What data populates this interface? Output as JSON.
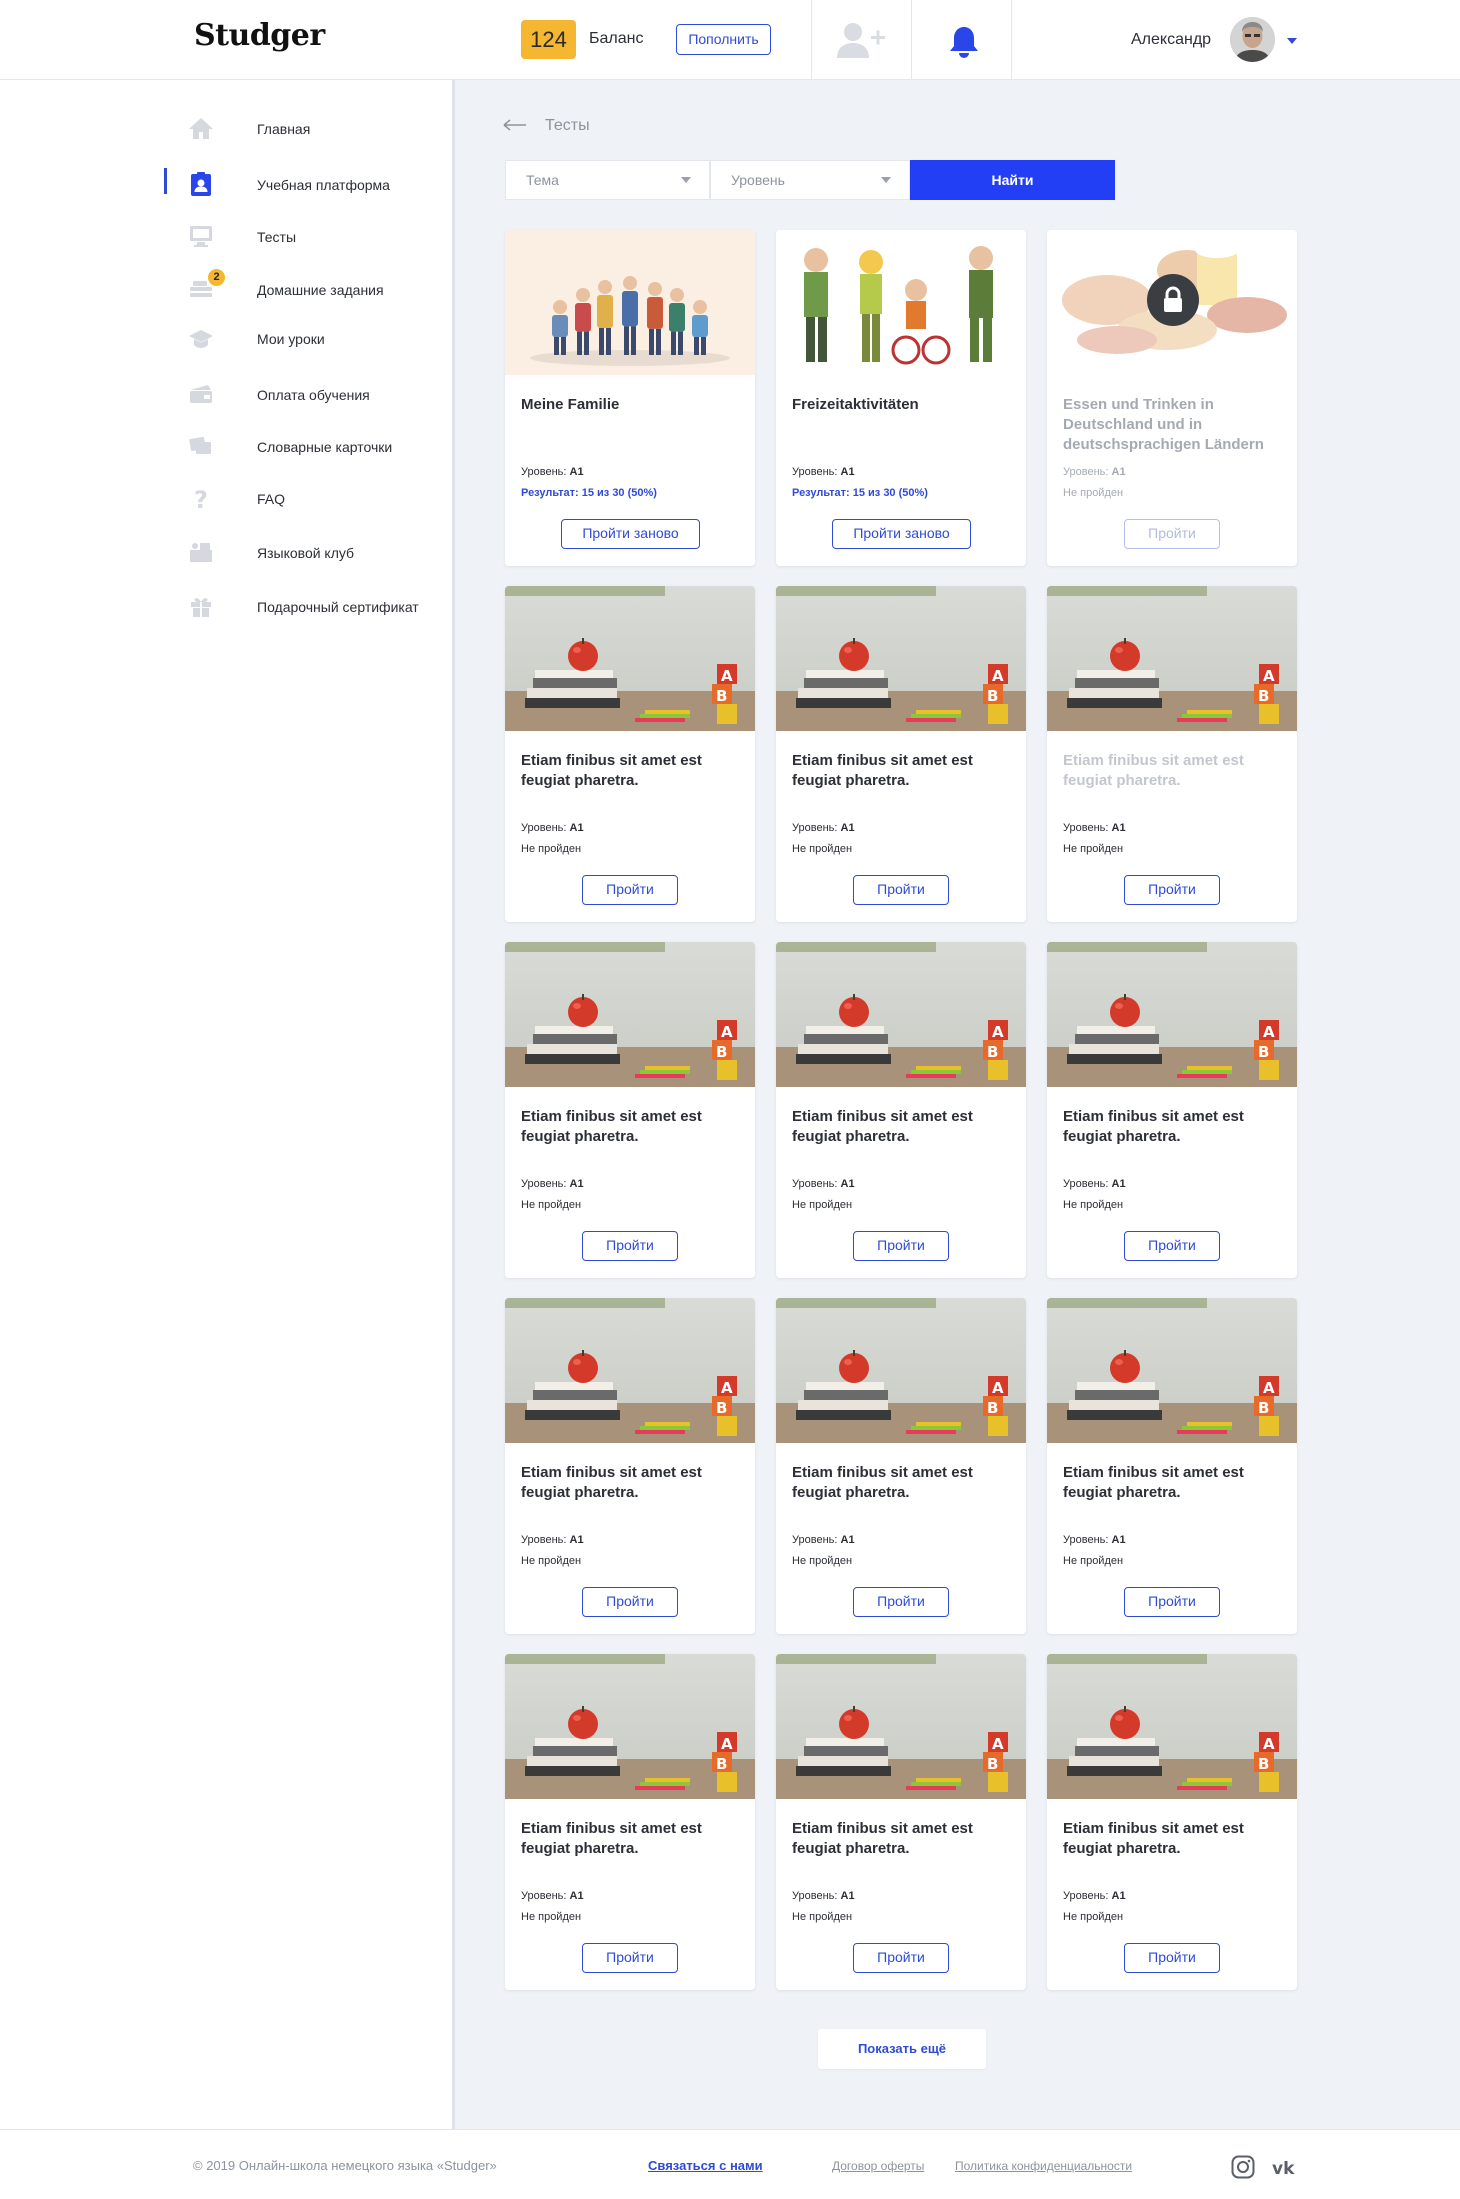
{
  "header": {
    "logo": "Studger",
    "balance_value": "124",
    "balance_label": "Баланс",
    "topup_label": "Пополнить",
    "user_name": "Александр"
  },
  "sidebar": {
    "items": [
      {
        "label": "Главная",
        "icon": "home-icon"
      },
      {
        "label": "Учебная платформа",
        "icon": "clipboard-user-icon",
        "active": true
      },
      {
        "label": "Тесты",
        "icon": "monitor-icon"
      },
      {
        "label": "Домашние задания",
        "icon": "homework-icon",
        "badge": "2"
      },
      {
        "label": "Мои уроки",
        "icon": "graduation-cap-icon"
      },
      {
        "label": "Оплата обучения",
        "icon": "payment-icon"
      },
      {
        "label": "Словарные карточки",
        "icon": "cards-icon"
      },
      {
        "label": "FAQ",
        "icon": "question-icon"
      },
      {
        "label": "Языковой клуб",
        "icon": "club-icon"
      },
      {
        "label": "Подарочный сертификат",
        "icon": "gift-icon"
      }
    ]
  },
  "breadcrumb": {
    "label": "Тесты"
  },
  "filters": {
    "topic_placeholder": "Тема",
    "level_placeholder": "Уровень",
    "find_label": "Найти"
  },
  "cards": [
    {
      "title": "Meine Familie",
      "level_prefix": "Уровень: ",
      "level": "A1",
      "status": "Результат: 15 из 30 (50%)",
      "button": "Пройти заново",
      "image": "family-illustration"
    },
    {
      "title": "Freizeitaktivitäten",
      "level_prefix": "Уровень: ",
      "level": "A1",
      "status": "Результат: 15 из 30 (50%)",
      "button": "Пройти заново",
      "image": "hobbies-illustration"
    },
    {
      "title": "Essen und Trinken in Deutschland und in deutschsprachigen Ländern",
      "level_prefix": "Уровень: ",
      "level": "A1",
      "status": "Не пройден",
      "button": "Пройти",
      "image": "food-illustration",
      "locked": true
    },
    {
      "title": "Etiam finibus sit amet est feugiat pharetra.",
      "level_prefix": "Уровень: ",
      "level": "A1",
      "status": "Не пройден",
      "button": "Пройти",
      "image": "books-apple-photo"
    },
    {
      "title": "Etiam finibus sit amet est feugiat pharetra.",
      "level_prefix": "Уровень: ",
      "level": "A1",
      "status": "Не пройден",
      "button": "Пройти",
      "image": "books-apple-photo"
    },
    {
      "title": "Etiam finibus sit amet est feugiat pharetra.",
      "level_prefix": "Уровень: ",
      "level": "A1",
      "status": "Не пройден",
      "button": "Пройти",
      "image": "books-apple-photo",
      "dim": true
    },
    {
      "title": "Etiam finibus sit amet est feugiat pharetra.",
      "level_prefix": "Уровень: ",
      "level": "A1",
      "status": "Не пройден",
      "button": "Пройти",
      "image": "books-apple-photo"
    },
    {
      "title": "Etiam finibus sit amet est feugiat pharetra.",
      "level_prefix": "Уровень: ",
      "level": "A1",
      "status": "Не пройден",
      "button": "Пройти",
      "image": "books-apple-photo"
    },
    {
      "title": "Etiam finibus sit amet est feugiat pharetra.",
      "level_prefix": "Уровень: ",
      "level": "A1",
      "status": "Не пройден",
      "button": "Пройти",
      "image": "books-apple-photo"
    },
    {
      "title": "Etiam finibus sit amet est feugiat pharetra.",
      "level_prefix": "Уровень: ",
      "level": "A1",
      "status": "Не пройден",
      "button": "Пройти",
      "image": "books-apple-photo"
    },
    {
      "title": "Etiam finibus sit amet est feugiat pharetra.",
      "level_prefix": "Уровень: ",
      "level": "A1",
      "status": "Не пройден",
      "button": "Пройти",
      "image": "books-apple-photo"
    },
    {
      "title": "Etiam finibus sit amet est feugiat pharetra.",
      "level_prefix": "Уровень: ",
      "level": "A1",
      "status": "Не пройден",
      "button": "Пройти",
      "image": "books-apple-photo"
    },
    {
      "title": "Etiam finibus sit amet est feugiat pharetra.",
      "level_prefix": "Уровень: ",
      "level": "A1",
      "status": "Не пройден",
      "button": "Пройти",
      "image": "books-apple-photo"
    },
    {
      "title": "Etiam finibus sit amet est feugiat pharetra.",
      "level_prefix": "Уровень: ",
      "level": "A1",
      "status": "Не пройден",
      "button": "Пройти",
      "image": "books-apple-photo"
    },
    {
      "title": "Etiam finibus sit amet est feugiat pharetra.",
      "level_prefix": "Уровень: ",
      "level": "A1",
      "status": "Не пройден",
      "button": "Пройти",
      "image": "books-apple-photo"
    }
  ],
  "show_more_label": "Показать ещё",
  "footer": {
    "copyright": "© 2019 Онлайн-школа немецкого языка «Studger»",
    "contact": "Связаться с нами",
    "offer": "Договор оферты",
    "privacy": "Политика конфиденциальности"
  },
  "colors": {
    "accent": "#2f4bd6",
    "button_primary": "#233ff5",
    "balance_badge": "#f5b731",
    "background": "#eff2f6"
  }
}
